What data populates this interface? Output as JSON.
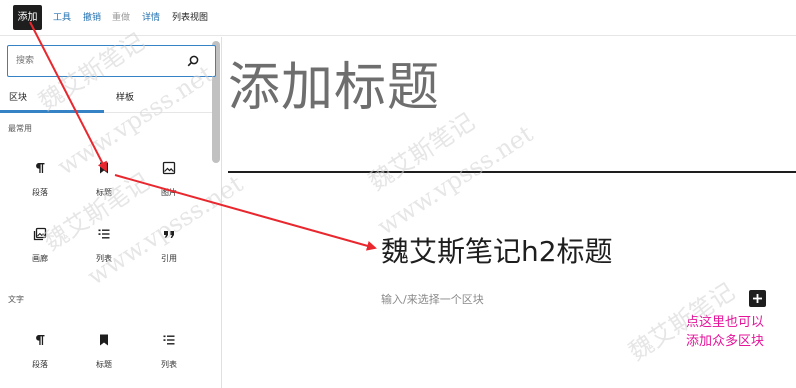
{
  "topbar": {
    "add_label": "添加",
    "tools_label": "工具",
    "undo_label": "撤销",
    "redo_label": "重做",
    "details_label": "详情",
    "list_view_label": "列表视图"
  },
  "inserter": {
    "search": {
      "placeholder": "搜索",
      "value": ""
    },
    "tabs": [
      {
        "label": "区块"
      },
      {
        "label": "样板"
      }
    ],
    "sections": [
      {
        "title": "最常用",
        "items": [
          {
            "label": "段落",
            "icon": "paragraph-icon"
          },
          {
            "label": "标题",
            "icon": "heading-icon"
          },
          {
            "label": "图片",
            "icon": "image-icon"
          },
          {
            "label": "画廊",
            "icon": "gallery-icon"
          },
          {
            "label": "列表",
            "icon": "list-icon"
          },
          {
            "label": "引用",
            "icon": "quote-icon"
          }
        ]
      },
      {
        "title": "文字",
        "items": [
          {
            "label": "段落",
            "icon": "paragraph-icon"
          },
          {
            "label": "标题",
            "icon": "heading-icon"
          },
          {
            "label": "列表",
            "icon": "list-icon"
          }
        ]
      }
    ]
  },
  "editor": {
    "post_title": "添加标题",
    "heading_h2": "魏艾斯笔记h2标题",
    "block_placeholder": "输入/来选择一个区块"
  },
  "annotation": {
    "line1": "点这里也可以",
    "line2": "添加众多区块",
    "color": "#e5139a"
  },
  "watermark": {
    "site": "www.vpsss.net",
    "name": "魏艾斯笔记"
  },
  "colors": {
    "accent": "#3582c4",
    "arrow": "#e8282e",
    "dark": "#1e1e1e"
  }
}
